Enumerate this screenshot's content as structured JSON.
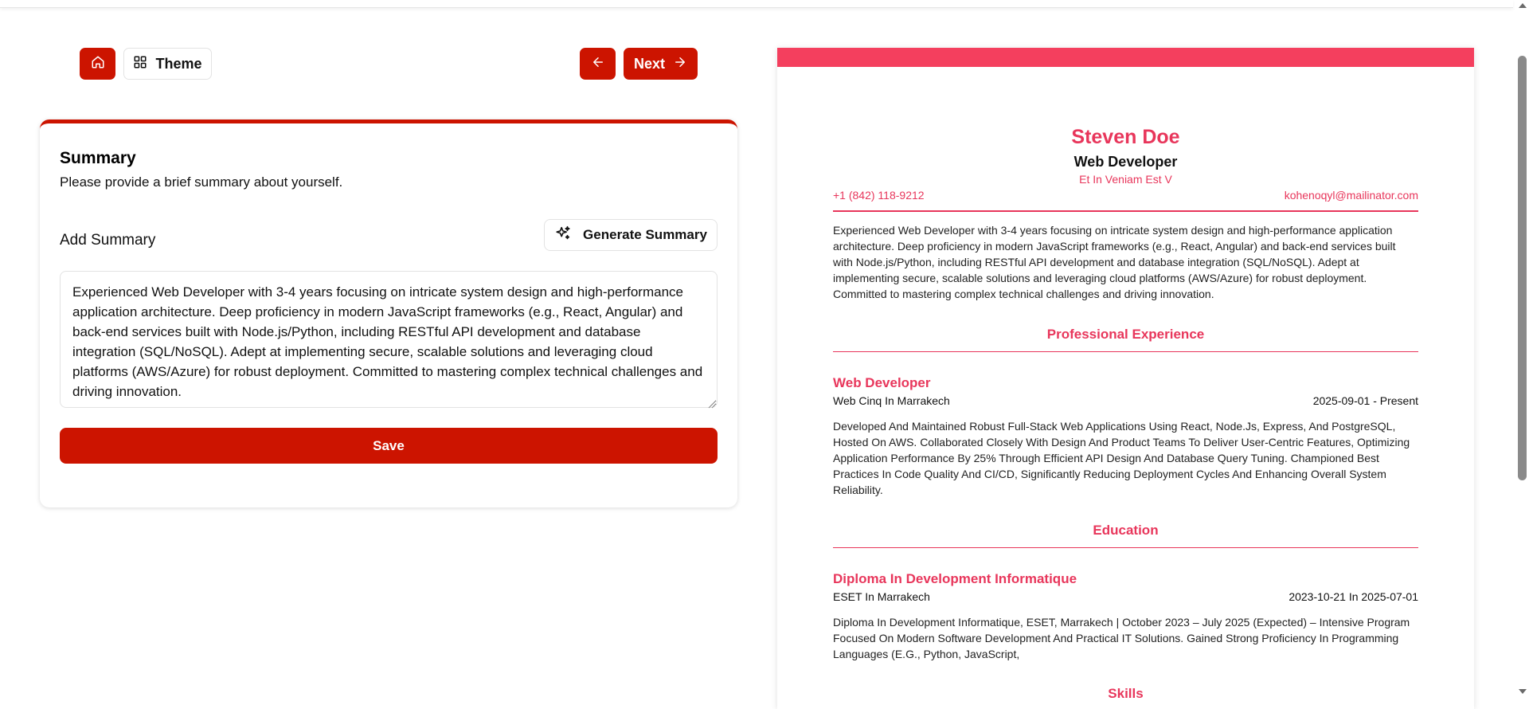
{
  "toolbar": {
    "home_icon": "home-icon",
    "theme_label": "Theme",
    "theme_icon": "grid-icon",
    "prev_icon": "arrow-left-icon",
    "next_label": "Next",
    "next_icon": "arrow-right-icon"
  },
  "colors": {
    "primary": "#cc1400",
    "resume_accent": "#e8365b",
    "resume_band": "#f43f5e"
  },
  "form": {
    "title": "Summary",
    "subtitle": "Please provide a brief summary about yourself.",
    "field_label": "Add Summary",
    "generate_label": "Generate Summary",
    "generate_icon": "sparkles-icon",
    "summary_value": "Experienced Web Developer with 3-4 years focusing on intricate system design and high-performance application architecture. Deep proficiency in modern JavaScript frameworks (e.g., React, Angular) and back-end services built with Node.js/Python, including RESTful API development and database integration (SQL/NoSQL). Adept at implementing secure, scalable solutions and leveraging cloud platforms (AWS/Azure) for robust deployment. Committed to mastering complex technical challenges and driving innovation.",
    "save_label": "Save"
  },
  "resume": {
    "name": "Steven Doe",
    "job_title": "Web Developer",
    "address": "Et In Veniam Est V",
    "phone": "+1 (842) 118-9212",
    "email": "kohenoqyl@mailinator.com",
    "summary": "Experienced Web Developer with 3-4 years focusing on intricate system design and high-performance application architecture. Deep proficiency in modern JavaScript frameworks (e.g., React, Angular) and back-end services built with Node.js/Python, including RESTful API development and database integration (SQL/NoSQL). Adept at implementing secure, scalable solutions and leveraging cloud platforms (AWS/Azure) for robust deployment. Committed to mastering complex technical challenges and driving innovation.",
    "experience_heading": "Professional Experience",
    "experience": {
      "title": "Web Developer",
      "company": "Web Cinq In Marrakech",
      "dates": "2025-09-01 - Present",
      "description": "Developed And Maintained Robust Full-Stack Web Applications Using React, Node.Js, Express, And PostgreSQL, Hosted On AWS. Collaborated Closely With Design And Product Teams To Deliver User-Centric Features, Optimizing Application Performance By 25% Through Efficient API Design And Database Query Tuning. Championed Best Practices In Code Quality And CI/CD, Significantly Reducing Deployment Cycles And Enhancing Overall System Reliability."
    },
    "education_heading": "Education",
    "education": {
      "title": "Diploma In Development Informatique",
      "school": "ESET In Marrakech",
      "dates": "2023-10-21 In 2025-07-01",
      "description": "Diploma In Development Informatique, ESET, Marrakech | October 2023 – July 2025 (Expected) – Intensive Program Focused On Modern Software Development And Practical IT Solutions. Gained Strong Proficiency In Programming Languages (E.G., Python, JavaScript,"
    },
    "skills_heading": "Skills"
  }
}
